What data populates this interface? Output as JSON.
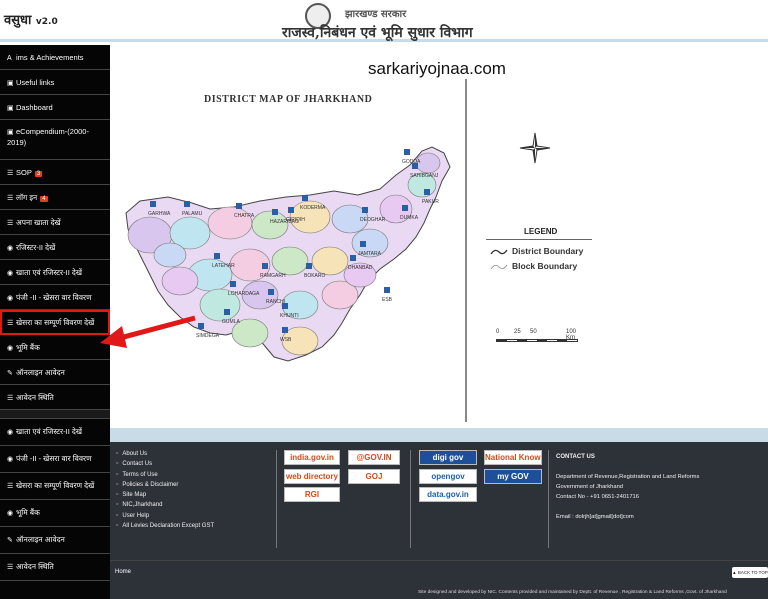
{
  "header": {
    "logo_main": "वसुधा",
    "logo_version": "v2.0",
    "gov_title": "झारखण्ड सरकार",
    "dept_title": "राजस्व,निबंधन एवं भूमि सुधार विभाग"
  },
  "sidebar": {
    "items": [
      {
        "icon": "A",
        "label": "ims & Achievements",
        "badge": ""
      },
      {
        "icon": "▣",
        "label": "Useful links",
        "badge": ""
      },
      {
        "icon": "▣",
        "label": "Dashboard",
        "badge": ""
      },
      {
        "icon": "▣",
        "label": "eCompendium-(2000-2019)",
        "badge": ""
      },
      {
        "icon": "☰",
        "label": "SOP",
        "badge": "3"
      },
      {
        "icon": "☰",
        "label": "लॉग इन",
        "badge": "4"
      },
      {
        "icon": "☰",
        "label": "अपना खाता देखें",
        "badge": ""
      },
      {
        "icon": "◉",
        "label": "रजिस्टर-II देखें",
        "badge": ""
      },
      {
        "icon": "◉",
        "label": "खाता एवं रजिस्टर-II देखें",
        "badge": ""
      },
      {
        "icon": "◉",
        "label": "पंजी -II - खेसरा वार विवरण",
        "badge": ""
      },
      {
        "icon": "☰",
        "label": "खेसरा का सम्पूर्ण विवरण देखें",
        "badge": ""
      },
      {
        "icon": "◉",
        "label": "भूमि बैंक",
        "badge": ""
      },
      {
        "icon": "✎",
        "label": "ऑनलाइन आवेदन",
        "badge": ""
      },
      {
        "icon": "☰",
        "label": "आवेदन स्थिति",
        "badge": ""
      }
    ],
    "items_lower": [
      {
        "icon": "◉",
        "label": "खाता एवं रजिस्टर-II देखें"
      },
      {
        "icon": "◉",
        "label": "पंजी -II - खेसरा वार विवरण"
      },
      {
        "icon": "☰",
        "label": "खेसरा का सम्पूर्ण विवरण देखें"
      },
      {
        "icon": "◉",
        "label": "भूमि बैंक"
      },
      {
        "icon": "✎",
        "label": "ऑनलाइन आवेदन"
      },
      {
        "icon": "☰",
        "label": "आवेदन स्थिति"
      }
    ]
  },
  "main": {
    "watermark": "sarkariyojnaa.com",
    "map_title": "DISTRICT MAP OF JHARKHAND",
    "districts": [
      "SAHIBGANJ",
      "GODDA",
      "PAKUR",
      "DUMKA",
      "DEOGHAR",
      "JAMTARA",
      "GIRIDIH",
      "KODERMA",
      "CHATRA",
      "PALAMU",
      "GARHWA",
      "LATEHAR",
      "HAZARIBAG",
      "RAMGARH",
      "BOKARO",
      "DHANBAD",
      "LOHARDAGA",
      "RANCHI",
      "GUMLA",
      "KHUNTI",
      "SIMDEGA",
      "WSB",
      "ESB"
    ],
    "legend": {
      "title": "LEGEND",
      "district_boundary": "District Boundary",
      "block_boundary": "Block Boundary"
    },
    "scale": {
      "labels": [
        "0",
        "25",
        "50",
        "100 Km"
      ]
    }
  },
  "footer": {
    "links": [
      "About Us",
      "Contact Us",
      "Terms of Use",
      "Policies & Disclaimer",
      "Site Map",
      "NIC,Jharkhand",
      "User Help",
      "All Levies Declaration Except GST"
    ],
    "partner_logos": [
      "india.gov.in",
      "@GOV.IN",
      "web directory",
      "GOJ",
      "RGI",
      "digi gov",
      "National Knowledge Network",
      "opengov",
      "my GOV",
      "data.gov.in"
    ],
    "contact": {
      "heading": "CONTACT US",
      "line1": "Department of Revenue,Registration and Land Reforms",
      "line2": "Government of Jharkhand",
      "phone": "Contact No - +91 0651-2401716",
      "email": "Email : dolrjh[at]gmail[dot]com"
    },
    "home": "Home",
    "back_to_top": "BACK TO TOP",
    "credits": "Site designed and developed by NIC. Contents provided and maintained by Deptt. of Revenue , Registration & Land Reforms ,Govt. of Jharkhand"
  }
}
